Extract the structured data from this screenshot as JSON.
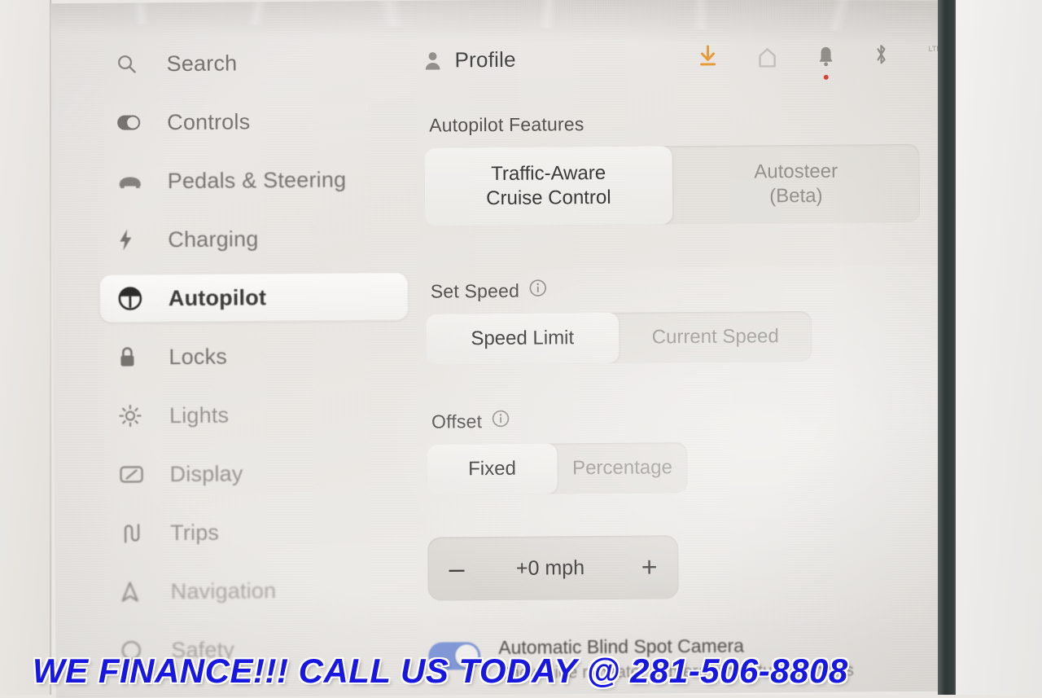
{
  "header": {
    "profile_label": "Profile",
    "icons": [
      {
        "name": "download-icon",
        "glyph": "download",
        "color": "#e8962e"
      },
      {
        "name": "home-icon",
        "glyph": "home",
        "color": "#b9b5af"
      },
      {
        "name": "notifications-bell-icon",
        "glyph": "bell",
        "color": "#8d8a85",
        "badge_color": "#d23b2f"
      },
      {
        "name": "bluetooth-icon",
        "glyph": "bluetooth",
        "color": "#8d8a85"
      },
      {
        "name": "lte-signal-icon",
        "glyph": "signal",
        "label": "LTE",
        "color": "#8d8a85"
      }
    ]
  },
  "sidebar": {
    "items": [
      {
        "label": "Search",
        "icon": "search-icon",
        "selected": false
      },
      {
        "label": "Controls",
        "icon": "toggle-icon",
        "selected": false
      },
      {
        "label": "Pedals & Steering",
        "icon": "car-icon",
        "selected": false
      },
      {
        "label": "Charging",
        "icon": "bolt-icon",
        "selected": false
      },
      {
        "label": "Autopilot",
        "icon": "steering-wheel-icon",
        "selected": true
      },
      {
        "label": "Locks",
        "icon": "lock-icon",
        "selected": false
      },
      {
        "label": "Lights",
        "icon": "sun-icon",
        "selected": false
      },
      {
        "label": "Display",
        "icon": "display-icon",
        "selected": false
      },
      {
        "label": "Trips",
        "icon": "trips-icon",
        "selected": false
      },
      {
        "label": "Navigation",
        "icon": "navigation-arrow-icon",
        "selected": false
      },
      {
        "label": "Safety",
        "icon": "safety-icon",
        "selected": false
      }
    ]
  },
  "main": {
    "features": {
      "label": "Autopilot Features",
      "options": [
        {
          "line1": "Traffic-Aware",
          "line2": "Cruise Control",
          "selected": true
        },
        {
          "line1": "Autosteer",
          "line2": "(Beta)",
          "selected": false
        }
      ]
    },
    "set_speed": {
      "label": "Set Speed",
      "info": "i",
      "options": [
        {
          "line1": "Speed Limit",
          "selected": true
        },
        {
          "line1": "Current Speed",
          "selected": false
        }
      ]
    },
    "offset": {
      "label": "Offset",
      "info": "i",
      "options": [
        {
          "line1": "Fixed",
          "selected": true
        },
        {
          "line1": "Percentage",
          "selected": false
        }
      ]
    },
    "stepper": {
      "minus": "–",
      "value": "+0 mph",
      "plus": "+"
    },
    "blind_spot": {
      "title": "Automatic Blind Spot Camera",
      "subtitle": "Show side repeater camera when turn signal is",
      "toggle_on": true,
      "toggle_color": "#7b94d8"
    }
  },
  "banner": {
    "text": "WE FINANCE!!! CALL US TODAY @ 281-506-8808",
    "color": "#1717e0",
    "outline_color": "#ffffff"
  }
}
